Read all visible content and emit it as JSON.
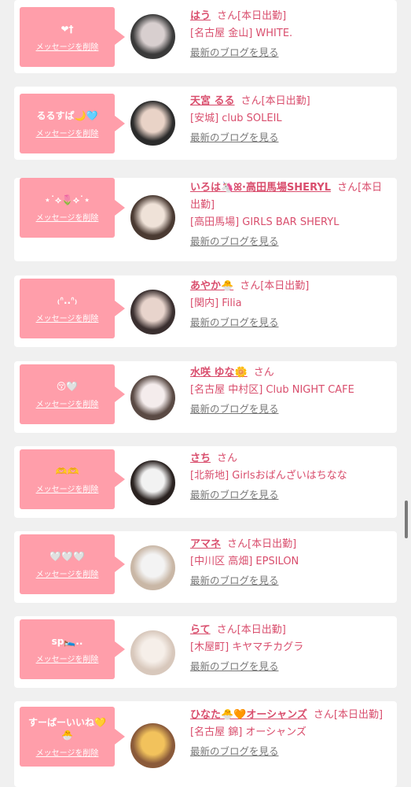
{
  "delete_label": "メッセージを削除",
  "blog_label": "最新のブログを見る",
  "accent_colors": {
    "bubble": "#ff9eaa",
    "name": "#d94e6d",
    "card": "#ffffff",
    "background": "#f0f0f0"
  },
  "cards": [
    {
      "message": "❤︎†",
      "name": "はう",
      "honorific": "さん",
      "status": "[本日出勤]",
      "shop": "[名古屋 金山] WHITE.",
      "avatar_colors": [
        "#3a3a3a",
        "#d8cfcf"
      ]
    },
    {
      "message": "るるすぱ🌙🩵",
      "name": "天宮 るる",
      "honorific": "さん",
      "status": "[本日出勤]",
      "shop": "[安城] club SOLEIL",
      "avatar_colors": [
        "#2b2b2b",
        "#e9d3c7"
      ]
    },
    {
      "message": "⋆˙⟡🌷⟡˙⋆",
      "name": "いろは🦄ꕤ·高田馬場SHERYL",
      "honorific": "さん",
      "status": "[本日出勤]",
      "shop": "[高田馬場] GIRLS BAR SHERYL",
      "avatar_colors": [
        "#4a3a32",
        "#efe2d8"
      ]
    },
    {
      "message": "₍ᐢ..ᐢ₎",
      "name": "あやか🐣",
      "honorific": "さん",
      "status": "[本日出勤]",
      "shop": "[関内] Filia",
      "avatar_colors": [
        "#3a2f2f",
        "#e8d4cc"
      ]
    },
    {
      "message": "😚🤍",
      "name": "水咲 ゆな🌼",
      "honorific": "さん",
      "status": "",
      "shop": "[名古屋 中村区] Club NIGHT CAFE",
      "avatar_colors": [
        "#5a4a44",
        "#f4ecec"
      ]
    },
    {
      "message": "🫶🫶",
      "name": "さち",
      "honorific": "さん",
      "status": "",
      "shop": "[北新地] Girlsおばんざいはちなな",
      "avatar_colors": [
        "#2a2220",
        "#f2f2f2"
      ]
    },
    {
      "message": "🤍🤍🤍",
      "name": "アマネ",
      "honorific": "さん",
      "status": "[本日出勤]",
      "shop": "[中川区 高畑] EPSILON",
      "avatar_colors": [
        "#c9b7a6",
        "#f3f3f3"
      ]
    },
    {
      "message": "sp🛌..",
      "name": "らて",
      "honorific": "さん",
      "status": "[本日出勤]",
      "shop": "[木屋町] キヤマチカグラ",
      "avatar_colors": [
        "#d8c8bc",
        "#f6efe9"
      ]
    },
    {
      "message": "すーぱーいいね💛🐣",
      "name": "ひなた🐣🧡オーシャンズ",
      "honorific": "さん",
      "status": "[本日出勤]",
      "shop": "[名古屋 錦] オーシャンズ",
      "avatar_colors": [
        "#8a5a3a",
        "#f2c25c"
      ]
    }
  ]
}
